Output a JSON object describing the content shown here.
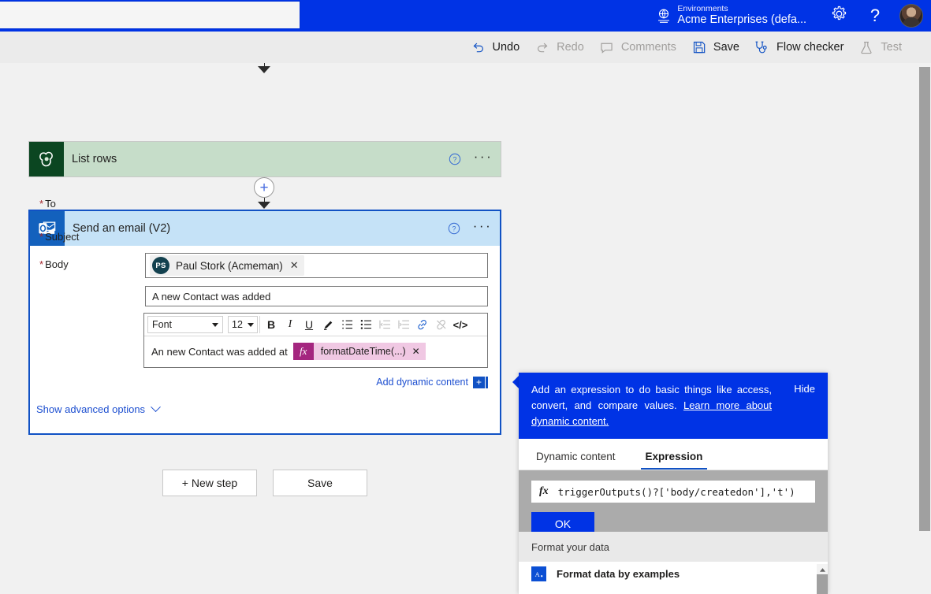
{
  "appbar": {
    "search_placeholder": "",
    "search_value": "",
    "env_label": "Environments",
    "env_name": "Acme Enterprises (defa...",
    "env_icon": "environment-globe-icon",
    "settings_icon": "gear-icon",
    "help_icon": "question-mark-icon",
    "avatar": "user-avatar",
    "bg": "#0033e5"
  },
  "commandbar": {
    "items": [
      {
        "label": "Undo",
        "icon": "undo-arrow-icon",
        "disabled": false
      },
      {
        "label": "Redo",
        "icon": "redo-arrow-icon",
        "disabled": true
      },
      {
        "label": "Comments",
        "icon": "comment-bubble-icon",
        "disabled": true
      },
      {
        "label": "Save",
        "icon": "floppy-disk-icon",
        "disabled": false
      },
      {
        "label": "Flow checker",
        "icon": "stethoscope-icon",
        "disabled": false
      },
      {
        "label": "Test",
        "icon": "flask-icon",
        "disabled": true
      }
    ]
  },
  "flow": {
    "list_rows_card": {
      "title": "List rows",
      "icon": "dataverse-icon",
      "icon_bg": "#0b4621",
      "body_bg": "#c6ddc9",
      "help_icon": "help-circle-icon",
      "more_icon": "ellipsis-icon"
    },
    "email_card": {
      "title": "Send an email (V2)",
      "icon": "outlook-icon",
      "icon_bg": "#1361bd",
      "header_bg": "#c5e2f7",
      "help_icon": "help-circle-icon",
      "more_icon": "ellipsis-icon",
      "fields": {
        "to": {
          "label": "To",
          "required_marker": "*",
          "chip_initials": "PS",
          "chip_name": "Paul Stork (Acmeman)",
          "chip_remove_icon": "close-x-icon"
        },
        "subject": {
          "label": "Subject",
          "required_marker": "*",
          "value": "A new Contact was added"
        },
        "body": {
          "label": "Body",
          "required_marker": "*",
          "text": "An new Contact was added at",
          "token_fx": "fx",
          "token_label": "formatDateTime(...)",
          "token_remove_icon": "close-x-icon",
          "toolbar": {
            "font_name": "Font",
            "font_size": "12",
            "bold": "B",
            "italic": "I",
            "underline": "U",
            "highlight_icon": "pen-highlight-icon",
            "numbered_list_icon": "numbered-list-icon",
            "bullet_list_icon": "bullet-list-icon",
            "outdent_icon": "decrease-indent-icon",
            "indent_icon": "increase-indent-icon",
            "link_icon": "link-icon",
            "unlink_icon": "unlink-icon",
            "code_icon": "</>"
          }
        }
      },
      "add_dynamic_content": "Add dynamic content",
      "add_dynamic_plus": "+",
      "show_advanced_options": "Show advanced options",
      "advanced_chevron": "chevron-down-icon"
    },
    "plus_node_icon": "+",
    "buttons": {
      "new_step": "+ New step",
      "save": "Save"
    }
  },
  "flyout": {
    "banner_text_part1": "Add an expression to do basic things like access, convert, and compare values. ",
    "banner_link": "Learn more about dynamic content.",
    "hide_label": "Hide",
    "tabs": [
      {
        "label": "Dynamic content",
        "active": false
      },
      {
        "label": "Expression",
        "active": true
      }
    ],
    "expression": {
      "fx_label": "fx",
      "value": "triggerOutputs()?['body/createdon'],'t')"
    },
    "ok_label": "OK",
    "list_header": "Format your data",
    "items": [
      {
        "label": "Format data by examples",
        "icon": "format-data-A-icon"
      }
    ],
    "scroll_up_icon": "scroll-up-arrow-icon"
  }
}
